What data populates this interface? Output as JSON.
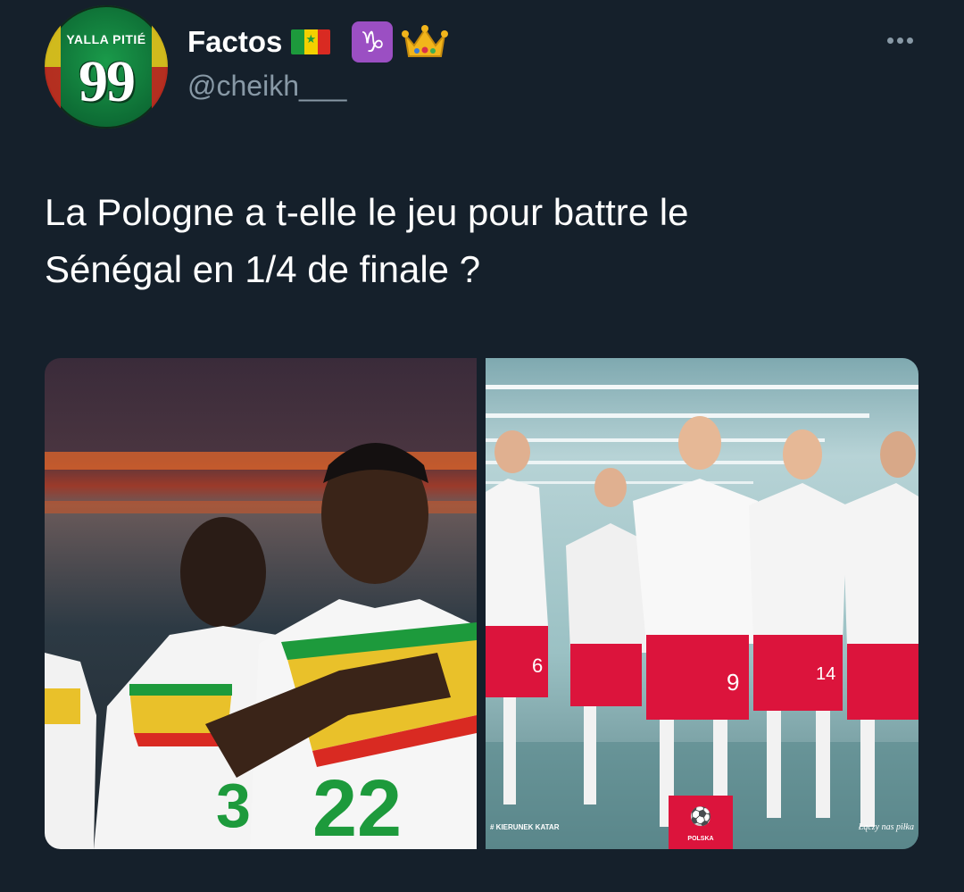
{
  "tweet": {
    "author_name": "Factos",
    "handle": "@cheikh___",
    "avatar": {
      "top_text": "YALLA PITIÉ",
      "number": "99"
    },
    "emoji": [
      "senegal-flag",
      "capricorn-sign",
      "crown"
    ],
    "zodiac_glyph": "♑",
    "text_line1": "La Pologne a t-elle le jeu pour battre le",
    "text_line2": "Sénégal en 1/4 de finale ?"
  },
  "media": {
    "left": {
      "jersey_numbers": [
        "3",
        "22"
      ]
    },
    "right": {
      "jersey_numbers": [
        "6",
        "9",
        "14"
      ],
      "bottom_left_caption": "# KIERUNEK KATAR",
      "bottom_right_caption": "Łączy nas piłka",
      "badge_text": "POLSKA"
    }
  },
  "colors": {
    "background": "#15202b",
    "handle": "#8899a6",
    "senegal_green": "#1d9a3c",
    "senegal_yellow": "#f3d000",
    "senegal_red": "#d92a22",
    "poland_red": "#dc143c"
  }
}
